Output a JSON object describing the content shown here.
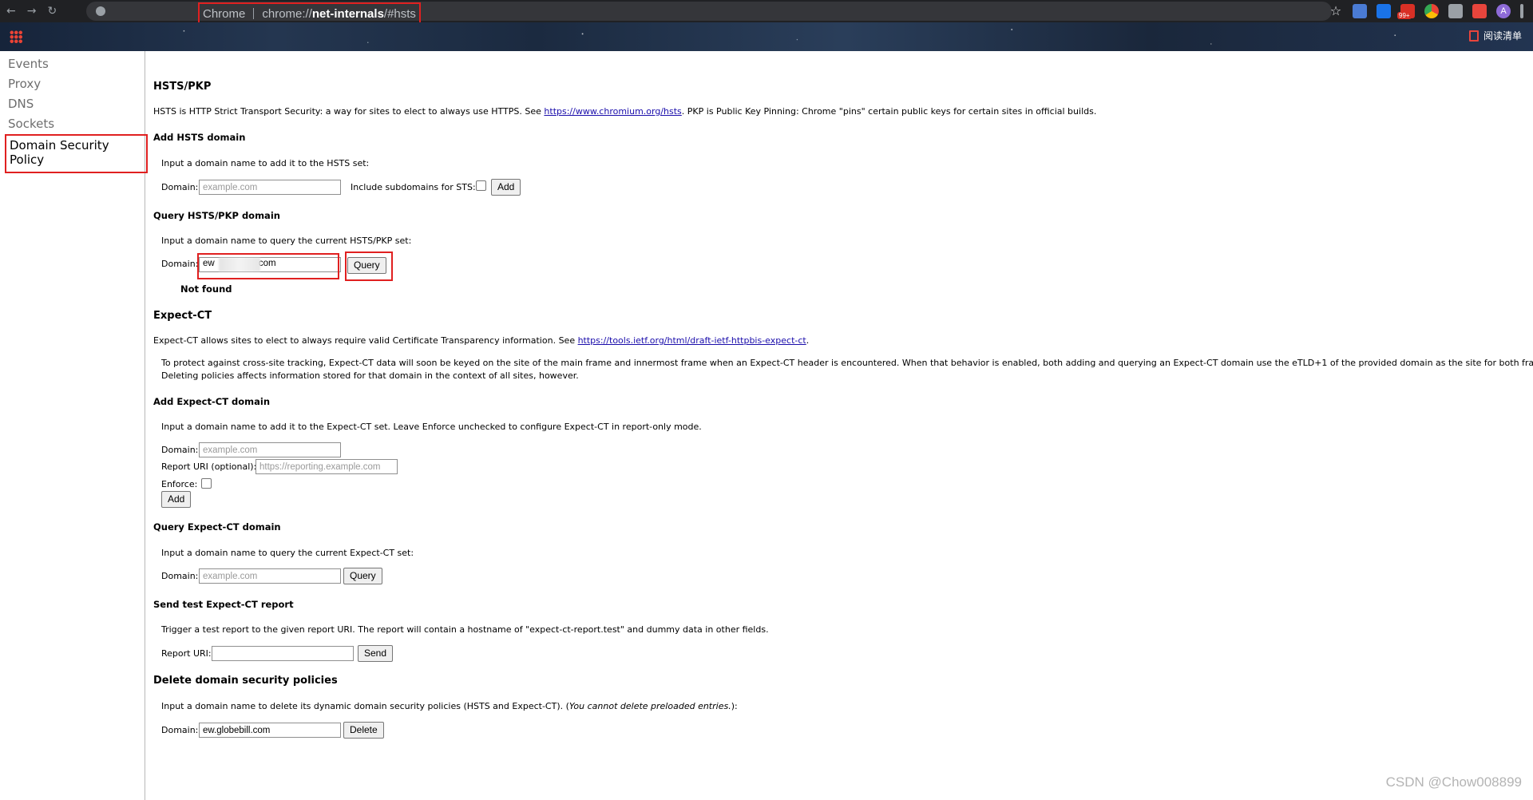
{
  "browser": {
    "omnibox_origin": "Chrome",
    "omnibox_url_scheme": "chrome://",
    "omnibox_url_host": "net-internals",
    "omnibox_url_hash": "/#hsts",
    "notification_badge": "99+",
    "profile_initial": "A",
    "reading_list_label": "阅读清单"
  },
  "sidebar": {
    "items": [
      {
        "label": "Events"
      },
      {
        "label": "Proxy"
      },
      {
        "label": "DNS"
      },
      {
        "label": "Sockets"
      },
      {
        "label": "Domain Security Policy"
      }
    ]
  },
  "hsts": {
    "title": "HSTS/PKP",
    "intro_before_link": "HSTS is HTTP Strict Transport Security: a way for sites to elect to always use HTTPS. See ",
    "intro_link": "https://www.chromium.org/hsts",
    "intro_after_link": ". PKP is Public Key Pinning: Chrome \"pins\" certain public keys for certain sites in official builds.",
    "add": {
      "title": "Add HSTS domain",
      "desc": "Input a domain name to add it to the HSTS set:",
      "domain_label": "Domain:",
      "domain_placeholder": "example.com",
      "subdomains_label": "Include subdomains for STS:",
      "add_button": "Add"
    },
    "query": {
      "title": "Query HSTS/PKP domain",
      "desc": "Input a domain name to query the current HSTS/PKP set:",
      "domain_label": "Domain:",
      "domain_value_prefix": "ew",
      "domain_value_suffix": ".com",
      "query_button": "Query",
      "result": "Not found"
    }
  },
  "expect_ct": {
    "title": "Expect-CT",
    "intro_before_link": "Expect-CT allows sites to elect to always require valid Certificate Transparency information. See ",
    "intro_link": "https://tools.ietf.org/html/draft-ietf-httpbis-expect-ct",
    "intro_after_link": ".",
    "notice_line1": "To protect against cross-site tracking, Expect-CT data will soon be keyed on the site of the main frame and innermost frame when an Expect-CT header is encountered. When that behavior is enabled, both adding and querying an Expect-CT domain use the eTLD+1 of the provided domain as the site for both frames.",
    "notice_line2": "Deleting policies affects information stored for that domain in the context of all sites, however.",
    "add": {
      "title": "Add Expect-CT domain",
      "desc": "Input a domain name to add it to the Expect-CT set. Leave Enforce unchecked to configure Expect-CT in report-only mode.",
      "domain_label": "Domain:",
      "domain_placeholder": "example.com",
      "report_uri_label": "Report URI (optional):",
      "report_uri_placeholder": "https://reporting.example.com",
      "enforce_label": "Enforce:",
      "add_button": "Add"
    },
    "query": {
      "title": "Query Expect-CT domain",
      "desc": "Input a domain name to query the current Expect-CT set:",
      "domain_label": "Domain:",
      "domain_placeholder": "example.com",
      "query_button": "Query"
    },
    "test_report": {
      "title": "Send test Expect-CT report",
      "desc": "Trigger a test report to the given report URI. The report will contain a hostname of \"expect-ct-report.test\" and dummy data in other fields.",
      "report_uri_label": "Report URI:",
      "send_button": "Send"
    }
  },
  "delete": {
    "title": "Delete domain security policies",
    "desc_plain": "Input a domain name to delete its dynamic domain security policies (HSTS and Expect-CT). (",
    "desc_italic": "You cannot delete preloaded entries.",
    "desc_end": "):",
    "domain_label": "Domain:",
    "domain_value": "ew.globebill.com",
    "delete_button": "Delete"
  },
  "watermark": "CSDN @Chow008899",
  "colors": {
    "annotation_red": "#e02020",
    "link_blue": "#1a0dab",
    "sidebar_text": "#6e6e6e"
  }
}
